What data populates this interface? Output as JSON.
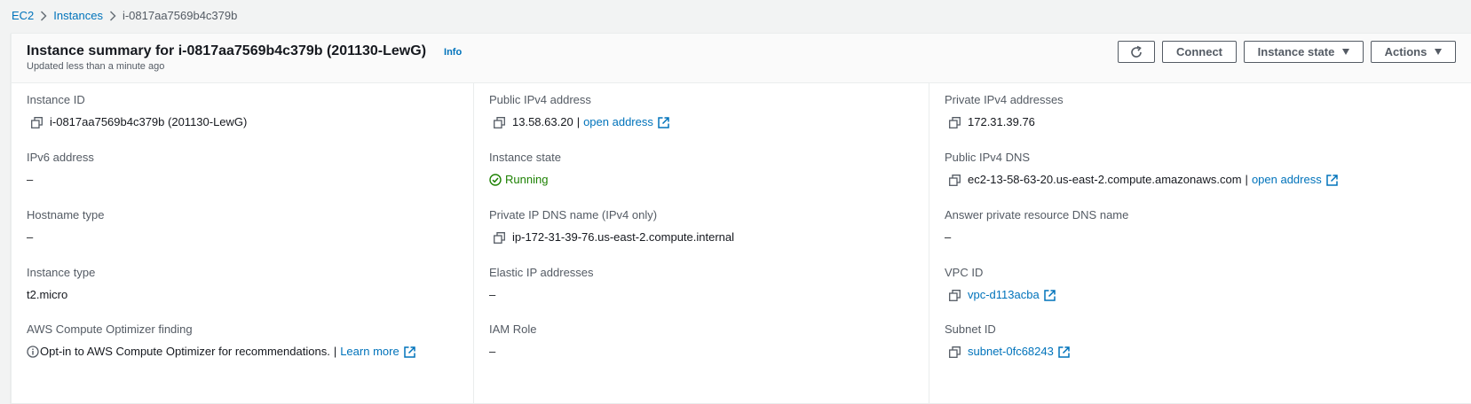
{
  "breadcrumb": {
    "items": [
      "EC2",
      "Instances"
    ],
    "current": "i-0817aa7569b4c379b"
  },
  "header": {
    "title": "Instance summary for i-0817aa7569b4c379b (201130-LewG)",
    "info": "Info",
    "subtitle": "Updated less than a minute ago",
    "buttons": {
      "connect": "Connect",
      "instance_state": "Instance state",
      "actions": "Actions"
    }
  },
  "fields": {
    "instance_id": {
      "label": "Instance ID",
      "value": "i-0817aa7569b4c379b (201130-LewG)"
    },
    "ipv6": {
      "label": "IPv6 address",
      "value": "–"
    },
    "hostname_type": {
      "label": "Hostname type",
      "value": "–"
    },
    "instance_type": {
      "label": "Instance type",
      "value": "t2.micro"
    },
    "optimizer": {
      "label": "AWS Compute Optimizer finding",
      "value": "Opt-in to AWS Compute Optimizer for recommendations.",
      "separator": "|",
      "link": "Learn more"
    },
    "public_ipv4": {
      "label": "Public IPv4 address",
      "value": "13.58.63.20",
      "separator": "|",
      "link": "open address"
    },
    "instance_state": {
      "label": "Instance state",
      "value": "Running"
    },
    "private_ip_dns": {
      "label": "Private IP DNS name (IPv4 only)",
      "value": "ip-172-31-39-76.us-east-2.compute.internal"
    },
    "elastic_ip": {
      "label": "Elastic IP addresses",
      "value": "–"
    },
    "iam_role": {
      "label": "IAM Role",
      "value": "–"
    },
    "private_ipv4": {
      "label": "Private IPv4 addresses",
      "value": "172.31.39.76"
    },
    "public_dns": {
      "label": "Public IPv4 DNS",
      "value": "ec2-13-58-63-20.us-east-2.compute.amazonaws.com",
      "separator": "|",
      "link": "open address"
    },
    "answer_dns": {
      "label": "Answer private resource DNS name",
      "value": "–"
    },
    "vpc_id": {
      "label": "VPC ID",
      "value": "vpc-d113acba"
    },
    "subnet_id": {
      "label": "Subnet ID",
      "value": "subnet-0fc68243"
    }
  },
  "colors": {
    "link": "#0073bb",
    "running": "#1d8102",
    "label": "#545b64"
  },
  "icons": [
    "chevron-right-icon",
    "refresh-icon",
    "caret-down-icon",
    "copy-icon",
    "external-link-icon",
    "check-circle-icon",
    "info-circle-icon"
  ]
}
